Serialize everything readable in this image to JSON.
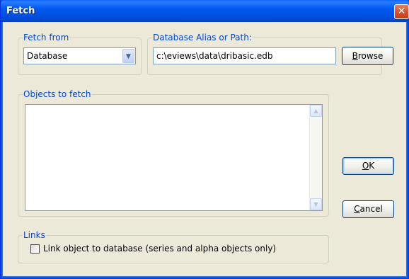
{
  "window": {
    "title": "Fetch",
    "close_symbol": "✕"
  },
  "fetch_from": {
    "legend": "Fetch from",
    "selected": "Database",
    "arrow": "▼"
  },
  "alias": {
    "legend": "Database Alias or Path:",
    "value": "c:\\eviews\\data\\dribasic.edb",
    "browse_label": "Browse"
  },
  "objects": {
    "legend": "Objects to fetch",
    "scroll_up": "▲",
    "scroll_down": "▼"
  },
  "buttons": {
    "ok_label": "OK",
    "cancel_label": "Cancel"
  },
  "links": {
    "legend": "Links",
    "checkbox_label": "Link object to database (series and alpha objects only)",
    "checked": false
  }
}
